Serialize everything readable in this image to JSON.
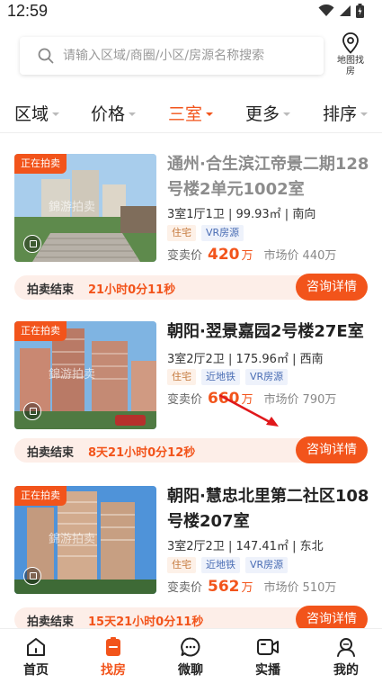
{
  "status": {
    "time": "12:59"
  },
  "search": {
    "placeholder": "请输入区域/商圈/小区/房源名称搜索",
    "map_label": "地图找房"
  },
  "filters": [
    {
      "label": "区域",
      "active": false
    },
    {
      "label": "价格",
      "active": false
    },
    {
      "label": "三室",
      "active": true
    },
    {
      "label": "更多",
      "active": false
    },
    {
      "label": "排序",
      "active": false
    }
  ],
  "listings": [
    {
      "badge": "正在拍卖",
      "watermark": "錦游拍卖",
      "title": "通州·合生滨江帝景二期128号楼2单元1002室",
      "spec": "3室1厅1卫 | 99.93㎡ | 南向",
      "tags": [
        "住宅",
        "VR房源"
      ],
      "price_label": "变卖价",
      "price": "420",
      "price_unit": "万",
      "market_label": "市场价",
      "market_price": "440万",
      "status_label": "拍卖结束",
      "countdown": "21小时0分11秒",
      "consult": "咨询详情"
    },
    {
      "badge": "正在拍卖",
      "watermark": "錦游拍卖",
      "title": "朝阳·翌景嘉园2号楼27E室",
      "spec": "3室2厅2卫 | 175.96㎡ | 西南",
      "tags": [
        "住宅",
        "近地铁",
        "VR房源"
      ],
      "price_label": "变卖价",
      "price": "660",
      "price_unit": "万",
      "market_label": "市场价",
      "market_price": "790万",
      "status_label": "拍卖结束",
      "countdown": "8天21小时0分12秒",
      "consult": "咨询详情"
    },
    {
      "badge": "正在拍卖",
      "watermark": "錦游拍卖",
      "title": "朝阳·慧忠北里第二社区108号楼207室",
      "spec": "3室2厅2卫 | 147.41㎡ | 东北",
      "tags": [
        "住宅",
        "近地铁",
        "VR房源"
      ],
      "price_label": "变卖价",
      "price": "562",
      "price_unit": "万",
      "market_label": "市场价",
      "market_price": "510万",
      "status_label": "拍卖结束",
      "countdown": "15天21小时0分11秒",
      "consult": "咨询详情"
    }
  ],
  "tabs": [
    {
      "label": "首页",
      "icon": "home-icon",
      "active": false
    },
    {
      "label": "找房",
      "icon": "find-house-icon",
      "active": true
    },
    {
      "label": "微聊",
      "icon": "chat-icon",
      "active": false
    },
    {
      "label": "实播",
      "icon": "live-video-icon",
      "active": false
    },
    {
      "label": "我的",
      "icon": "profile-icon",
      "active": false
    }
  ],
  "colors": {
    "accent": "#f2541b",
    "countdown_bg": "#fdeee8"
  }
}
